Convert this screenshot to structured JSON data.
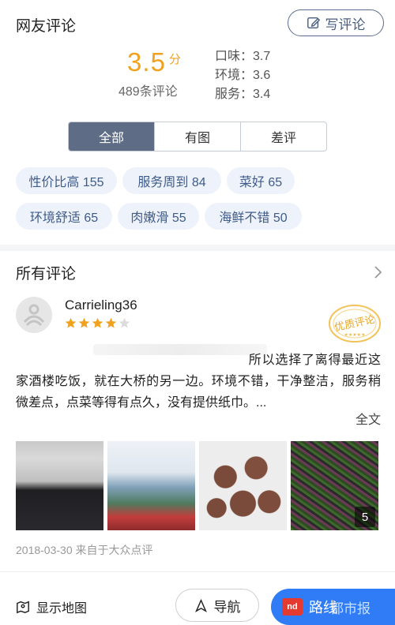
{
  "header": {
    "title": "网友评论",
    "write_label": "写评论"
  },
  "rating": {
    "score": "3.5",
    "unit": "分",
    "count_text": "489条评论",
    "subscores": [
      {
        "label": "口味：3.7"
      },
      {
        "label": "环境：3.6"
      },
      {
        "label": "服务：3.4"
      }
    ]
  },
  "filters": {
    "all": "全部",
    "with_photos": "有图",
    "negative": "差评"
  },
  "tags": [
    {
      "label": "性价比高 155"
    },
    {
      "label": "服务周到 84"
    },
    {
      "label": "菜好 65"
    },
    {
      "label": "环境舒适 65"
    },
    {
      "label": "肉嫩滑 55"
    },
    {
      "label": "海鲜不错 50"
    }
  ],
  "all_reviews": {
    "title": "所有评论"
  },
  "review": {
    "username": "Carrieling36",
    "stars": 4,
    "stars_max": 5,
    "text": "所以选择了离得最近这家酒楼吃饭，就在大桥的另一边。环境不错，干净整洁，服务稍微差点，点菜等得有点久，没有提供纸巾。...",
    "full_text_label": "全文",
    "photo_count": "5",
    "meta": "2018-03-30 来自于大众点评",
    "badge_text": "优质评论"
  },
  "bottom_bar": {
    "map_label": "显示地图",
    "nav_label": "导航",
    "route_label": "路线",
    "route_logo": "nd",
    "watermark": "都市报"
  },
  "colors": {
    "accent_orange": "#f0a11e",
    "segment_active": "#5f6c85",
    "tag_bg": "#eef3fb",
    "tag_text": "#3f5b8a",
    "route_blue": "#2f7cf6"
  }
}
